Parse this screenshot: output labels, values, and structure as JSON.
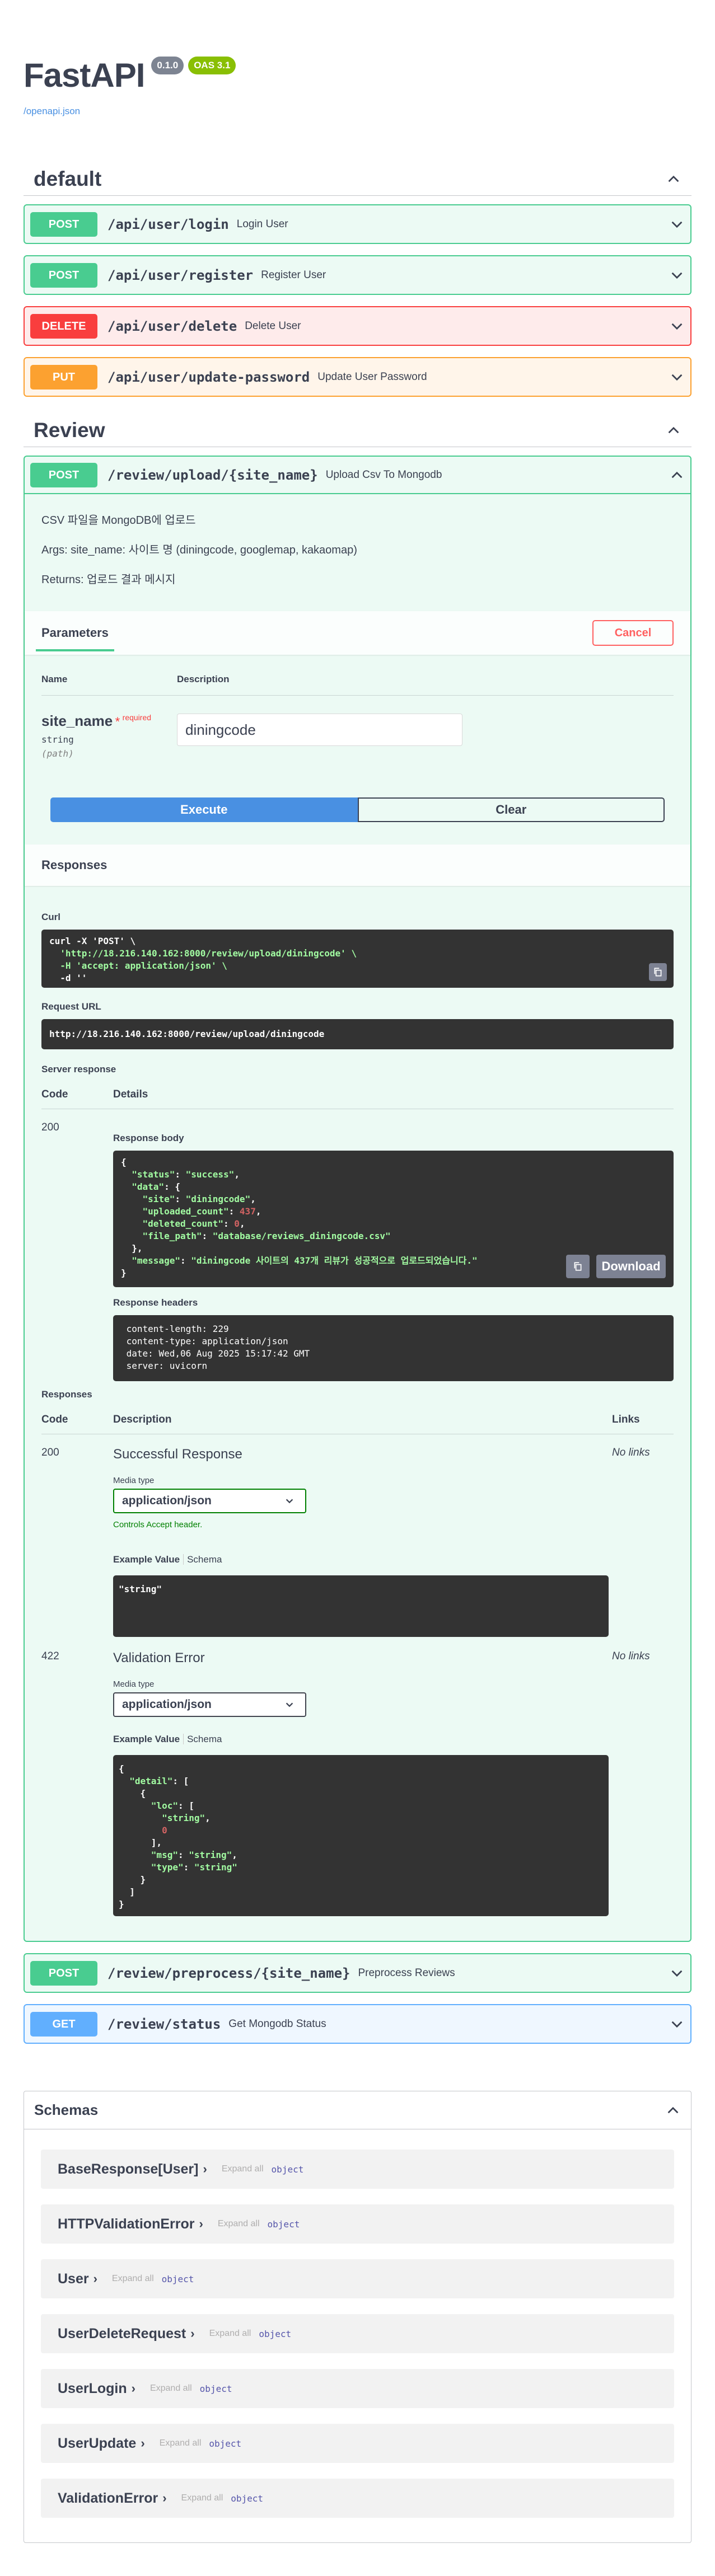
{
  "info": {
    "title": "FastAPI",
    "version": "0.1.0",
    "oas": "OAS 3.1",
    "spec_link": "/openapi.json"
  },
  "colors": {
    "post": "#49cc90",
    "get": "#61affe",
    "put": "#fca130",
    "delete": "#f93e3e",
    "execute": "#4990e2"
  },
  "default_tag": {
    "name": "default",
    "ops": [
      {
        "method": "POST",
        "path": "/api/user/login",
        "summary": "Login User"
      },
      {
        "method": "POST",
        "path": "/api/user/register",
        "summary": "Register User"
      },
      {
        "method": "DELETE",
        "path": "/api/user/delete",
        "summary": "Delete User"
      },
      {
        "method": "PUT",
        "path": "/api/user/update-password",
        "summary": "Update User Password"
      }
    ]
  },
  "review_tag": {
    "name": "Review",
    "open_op": {
      "method": "POST",
      "path": "/review/upload/{site_name}",
      "summary": "Upload Csv To Mongodb",
      "doc": [
        "CSV 파일을 MongoDB에 업로드",
        "Args: site_name: 사이트 명 (diningcode, googlemap, kakaomap)",
        "Returns: 업로드 결과 메시지"
      ],
      "parameters_tab": "Parameters",
      "cancel_label": "Cancel",
      "param_col_name": "Name",
      "param_col_desc": "Description",
      "param": {
        "name": "site_name",
        "required_mark": "*",
        "required_label": "required",
        "type": "string",
        "in": "(path)",
        "value": "diningcode"
      },
      "execute_label": "Execute",
      "clear_label": "Clear",
      "responses_title": "Responses",
      "curl_label": "Curl",
      "curl_lines": [
        "curl -X 'POST' \\",
        "  'http://18.216.140.162:8000/review/upload/diningcode' \\",
        "  -H 'accept: application/json' \\",
        "  -d ''"
      ],
      "request_url_label": "Request URL",
      "request_url": "http://18.216.140.162:8000/review/upload/diningcode",
      "server_response_label": "Server response",
      "col_code": "Code",
      "col_details": "Details",
      "live_code": "200",
      "response_body_label": "Response body",
      "body": {
        "status": "success",
        "site": "diningcode",
        "uploaded_count": "437",
        "deleted_count": "0",
        "file_path": "database/reviews_diningcode.csv",
        "message": "diningcode 사이트의 437개 리뷰가 성공적으로 업로드되었습니다."
      },
      "download_label": "Download",
      "response_headers_label": "Response headers",
      "response_headers": [
        " content-length: 229 ",
        " content-type: application/json ",
        " date: Wed,06 Aug 2025 15:17:42 GMT ",
        " server: uvicorn "
      ],
      "responses_label": "Responses",
      "col_description": "Description",
      "col_links": "Links",
      "documented": [
        {
          "code": "200",
          "title": "Successful Response",
          "links": "No links",
          "media_type_label": "Media type",
          "media_type": "application/json",
          "controls": "Controls Accept header.",
          "example_value": "Example Value",
          "schema": "Schema",
          "example": "\"string\""
        },
        {
          "code": "422",
          "title": "Validation Error",
          "links": "No links",
          "media_type_label": "Media type",
          "media_type": "application/json",
          "example_value": "Example Value",
          "schema": "Schema"
        }
      ]
    },
    "ops": [
      {
        "method": "POST",
        "path": "/review/preprocess/{site_name}",
        "summary": "Preprocess Reviews"
      },
      {
        "method": "GET",
        "path": "/review/status",
        "summary": "Get Mongodb Status"
      }
    ]
  },
  "schemas": {
    "title": "Schemas",
    "expand_all": "Expand all",
    "object_label": "object",
    "models": [
      "BaseResponse[User]",
      "HTTPValidationError",
      "User",
      "UserDeleteRequest",
      "UserLogin",
      "UserUpdate",
      "ValidationError"
    ]
  }
}
